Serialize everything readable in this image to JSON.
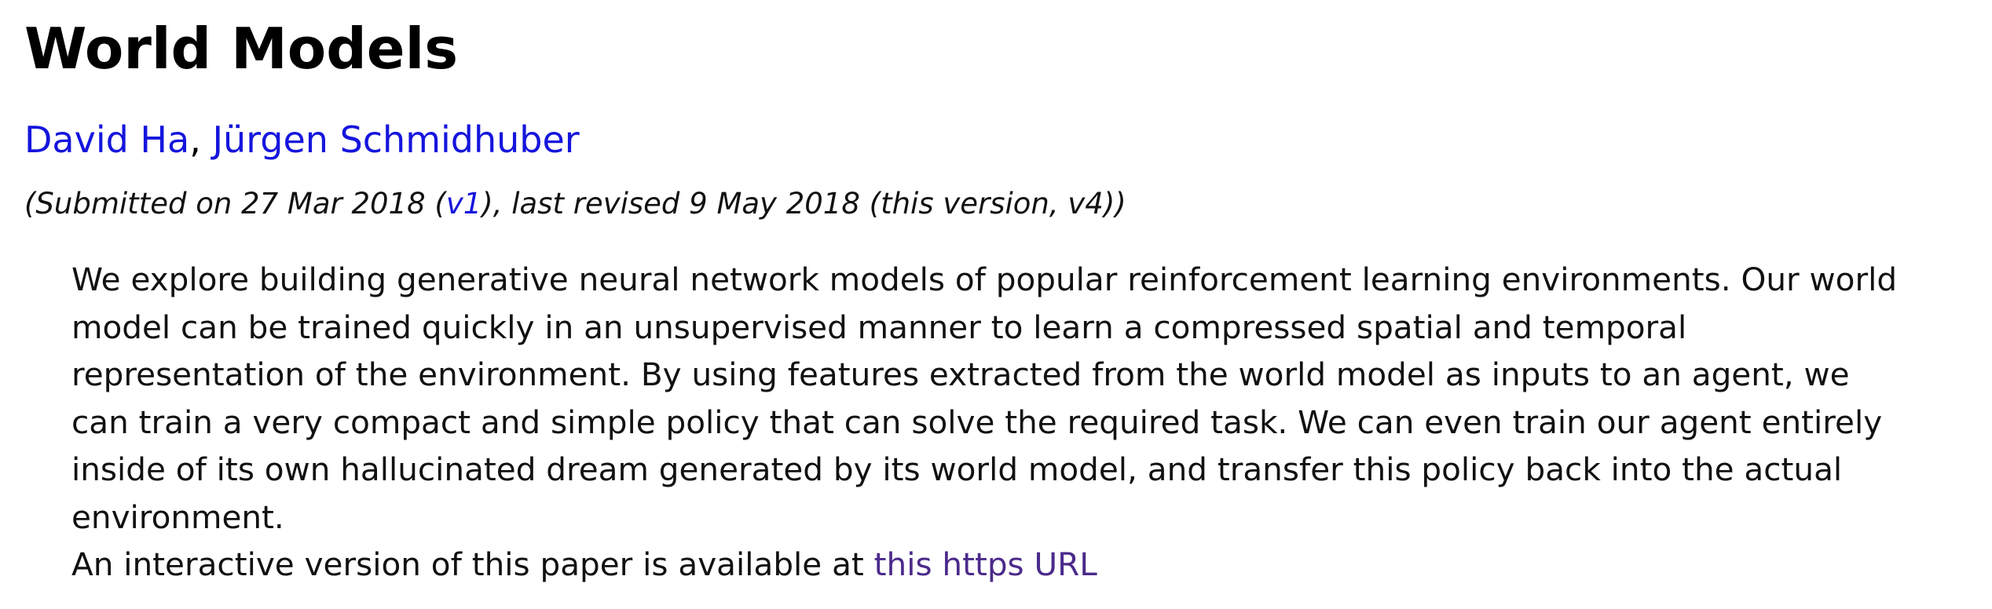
{
  "paper": {
    "title": "World Models",
    "authors": [
      {
        "name": "David Ha"
      },
      {
        "name": "Jürgen Schmidhuber"
      }
    ],
    "author_separator": ", ",
    "dateline": {
      "prefix": "(Submitted on 27 Mar 2018 (",
      "v1_link": "v1",
      "suffix": "), last revised 9 May 2018 (this version, v4))"
    },
    "abstract": {
      "lines": [
        "We explore building generative neural network models of popular reinforcement learning environments. Our world",
        "model can be trained quickly in an unsupervised manner to learn a compressed spatial and temporal",
        "representation of the environment. By using features extracted from the world model as inputs to an agent, we",
        "can train a very compact and simple policy that can solve the required task. We can even train our agent entirely",
        "inside of its own hallucinated dream generated by its world model, and transfer this policy back into the actual",
        "environment."
      ],
      "comment_prefix": "An interactive version of this paper is available at ",
      "comment_link": "this https URL"
    }
  },
  "colors": {
    "link": "#1515dd",
    "visited_link": "#4b2a8a",
    "text": "#111111"
  }
}
